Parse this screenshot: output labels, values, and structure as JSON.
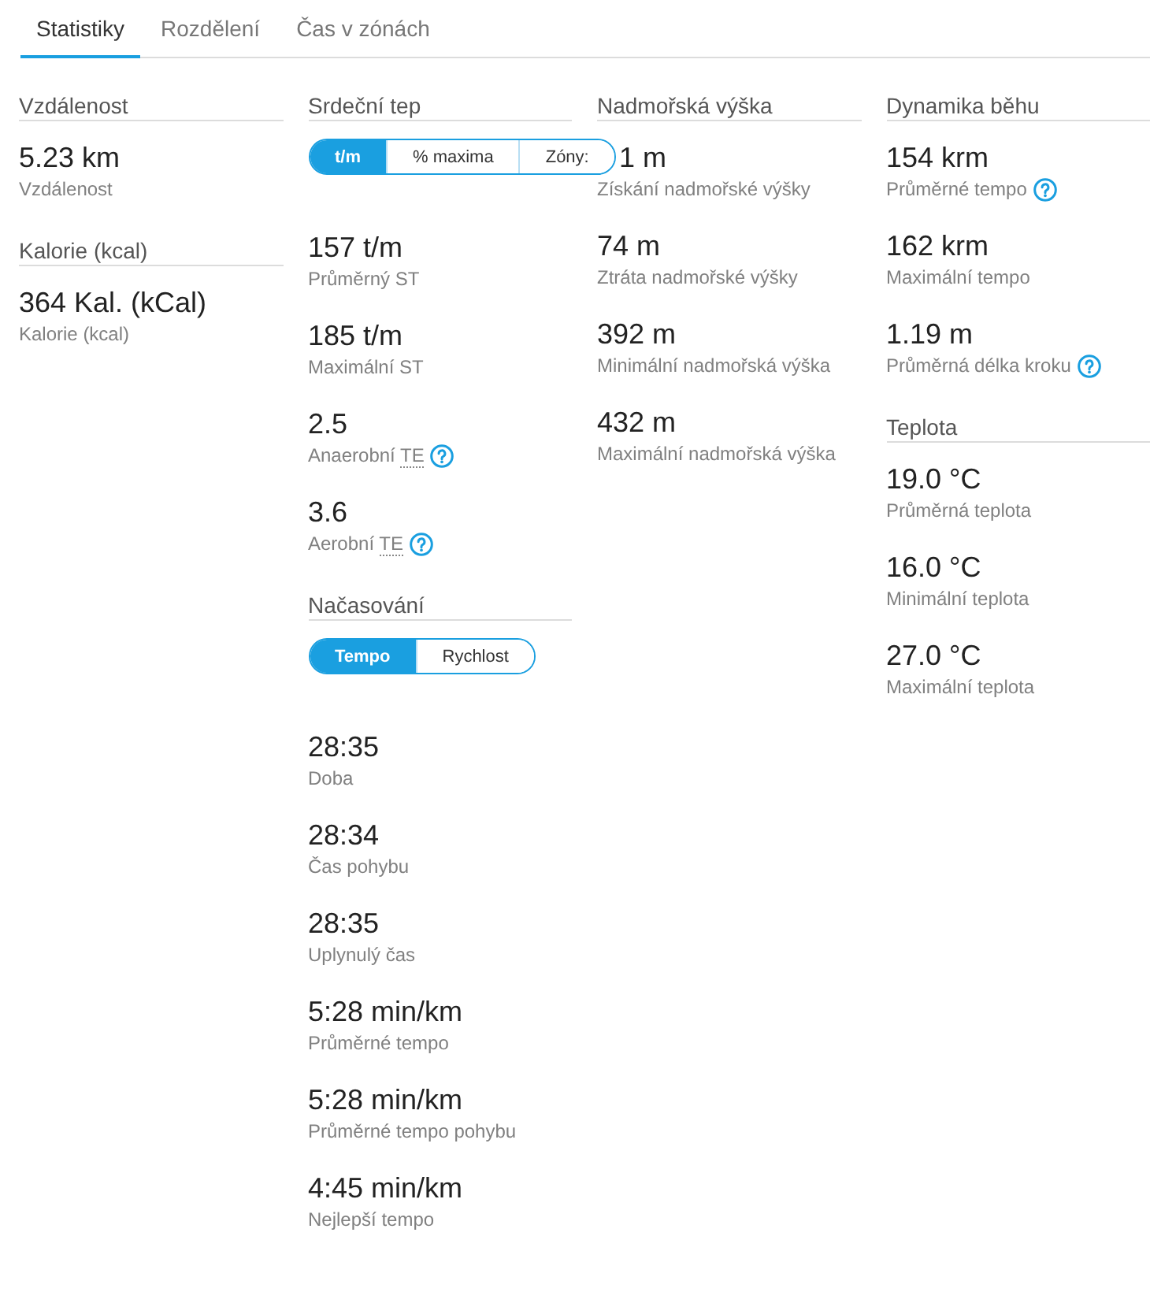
{
  "tabs": [
    {
      "label": "Statistiky",
      "selected": true
    },
    {
      "label": "Rozdělení",
      "selected": false
    },
    {
      "label": "Čas v zónách",
      "selected": false
    }
  ],
  "columns": [
    {
      "sections": [
        {
          "title": "Vzdálenost",
          "stats": [
            {
              "value": "5.23 km",
              "label": "Vzdálenost",
              "help": false
            }
          ]
        },
        {
          "title": "Kalorie (kcal)",
          "stats": [
            {
              "value": "364 Kal. (kCal)",
              "label": "Kalorie (kcal)",
              "help": false
            }
          ]
        }
      ]
    },
    {
      "sections": [
        {
          "title": "Srdeční tep",
          "toggle": [
            {
              "label": "t/m",
              "selected": true
            },
            {
              "label": "% maxima",
              "selected": false
            },
            {
              "label": "Zóny:",
              "selected": false
            }
          ],
          "stats": [
            {
              "value": "157 t/m",
              "label": "Průměrný ST",
              "help": false
            },
            {
              "value": "185 t/m",
              "label": "Maximální ST",
              "help": false
            },
            {
              "value": "2.5",
              "label": "Anaerobní",
              "abbr": "TE",
              "help": true
            },
            {
              "value": "3.6",
              "label": "Aerobní",
              "abbr": "TE",
              "help": true
            }
          ]
        },
        {
          "title": "Načasování",
          "toggle": [
            {
              "label": "Tempo",
              "selected": true
            },
            {
              "label": "Rychlost",
              "selected": false
            }
          ],
          "stats": [
            {
              "value": "28:35",
              "label": "Doba",
              "help": false
            },
            {
              "value": "28:34",
              "label": "Čas pohybu",
              "help": false
            },
            {
              "value": "28:35",
              "label": "Uplynulý čas",
              "help": false
            },
            {
              "value": "5:28 min/km",
              "label": "Průměrné tempo",
              "help": false
            },
            {
              "value": "5:28 min/km",
              "label": "Průměrné tempo pohybu",
              "help": false
            },
            {
              "value": "4:45 min/km",
              "label": "Nejlepší tempo",
              "help": false
            }
          ]
        }
      ]
    },
    {
      "sections": [
        {
          "title": "Nadmořská výška",
          "stats": [
            {
              "value": "1 m",
              "label": "Získání nadmořské výšky",
              "help": false
            },
            {
              "value": "74 m",
              "label": "Ztráta nadmořské výšky",
              "help": false
            },
            {
              "value": "392 m",
              "label": "Minimální nadmořská výška",
              "help": false
            },
            {
              "value": "432 m",
              "label": "Maximální nadmořská výška",
              "help": false
            }
          ]
        }
      ]
    },
    {
      "sections": [
        {
          "title": "Dynamika běhu",
          "stats": [
            {
              "value": "154 krm",
              "label": "Průměrné tempo",
              "help": true
            },
            {
              "value": "162 krm",
              "label": "Maximální tempo",
              "help": false
            },
            {
              "value": "1.19 m",
              "label": "Průměrná délka kroku",
              "help": true
            }
          ]
        },
        {
          "title": "Teplota",
          "stats": [
            {
              "value": "19.0 °C",
              "label": "Průměrná teplota",
              "help": false
            },
            {
              "value": "16.0 °C",
              "label": "Minimální teplota",
              "help": false
            },
            {
              "value": "27.0 °C",
              "label": "Maximální teplota",
              "help": false
            }
          ]
        }
      ]
    }
  ]
}
